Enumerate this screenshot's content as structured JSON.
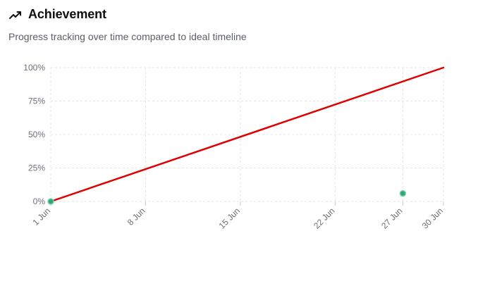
{
  "header": {
    "icon": "trending-up-icon",
    "title": "Achievement",
    "subtitle": "Progress tracking over time compared to ideal timeline"
  },
  "chart_data": {
    "type": "line",
    "title": "",
    "xlabel": "",
    "ylabel": "",
    "x_ticks": [
      "1 Jun",
      "8 Jun",
      "15 Jun",
      "22 Jun",
      "27 Jun",
      "30 Jun"
    ],
    "y_ticks": [
      "0%",
      "25%",
      "50%",
      "75%",
      "100%"
    ],
    "xlim": [
      "2024-06-01",
      "2024-06-30"
    ],
    "ylim": [
      0,
      100
    ],
    "grid": true,
    "series": [
      {
        "kind": "line",
        "color": "#e00000",
        "points": [
          [
            "1 Jun",
            0
          ],
          [
            "30 Jun",
            100
          ]
        ]
      },
      {
        "kind": "points",
        "color": "#2ea876",
        "points": [
          [
            "1 Jun",
            0
          ],
          [
            "27 Jun",
            6
          ]
        ]
      }
    ]
  }
}
